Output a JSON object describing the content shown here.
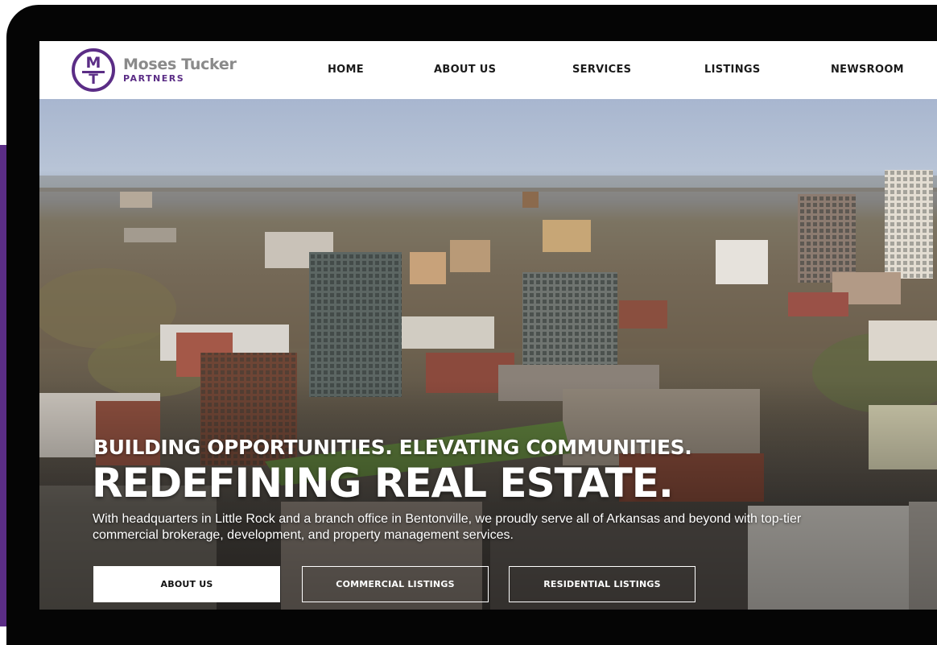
{
  "brand": {
    "logo_mark_top": "M",
    "logo_mark_bottom": "T",
    "name": "Moses Tucker",
    "sub": "PARTNERS",
    "color_primary": "#5b2d86"
  },
  "nav": {
    "items": [
      {
        "label": "HOME"
      },
      {
        "label": "ABOUT US"
      },
      {
        "label": "SERVICES"
      },
      {
        "label": "LISTINGS"
      },
      {
        "label": "NEWSROOM"
      }
    ]
  },
  "hero": {
    "tagline": "BUILDING OPPORTUNITIES. ELEVATING COMMUNITIES.",
    "headline": "REDEFINING REAL ESTATE.",
    "intro": "With headquarters in Little Rock and a branch office in Bentonville, we proudly serve all of Arkansas and beyond with top-tier commercial brokerage, development, and property management services.",
    "buttons": {
      "about": "ABOUT US",
      "commercial": "COMMERCIAL LISTINGS",
      "residential": "RESIDENTIAL LISTINGS"
    }
  }
}
